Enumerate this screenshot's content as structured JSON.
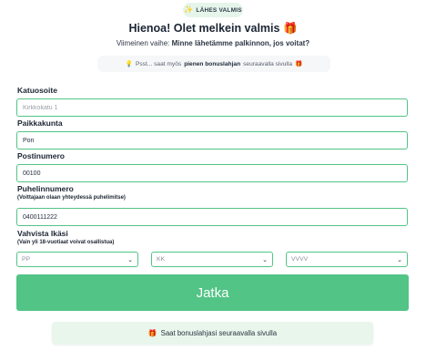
{
  "badge": {
    "icon": "magic-wand-icon",
    "text": "LÄHES VALMIS"
  },
  "header": {
    "title": "Hienoa! Olet melkein valmis",
    "title_icon": "gift-icon",
    "subtitle_prefix": "Viimeinen vaihe:",
    "subtitle_bold": "Minne lähetämme palkinnon, jos voitat?"
  },
  "tip": {
    "icon": "lightbulb-icon",
    "prefix": "Psst... saat myös",
    "bold": "pienen bonuslahjan",
    "suffix": "seuraavalla sivulla",
    "end_icon": "gift-icon"
  },
  "form": {
    "street": {
      "label": "Katuosoite",
      "placeholder": "Kirkkokatu 1"
    },
    "city": {
      "label": "Paikkakunta",
      "value": "Pori"
    },
    "postal": {
      "label": "Postinumero",
      "value": "00100"
    },
    "phone": {
      "label": "Puhelinnumero",
      "sublabel": "(Voittajaan olaan yhteydessä puhelimitse)",
      "value": "0400111222"
    },
    "age": {
      "label": "Vahvista Ikäsi",
      "sublabel": "(Vain yli 18-vuotiaat voivat osallistua)",
      "day": "PP",
      "month": "KK",
      "year": "VVVV"
    }
  },
  "submit_label": "Jatka",
  "footer": {
    "icon": "gift-icon",
    "text": "Saat bonuslahjasi seuraavalla sivulla"
  },
  "colors": {
    "accent": "#52c486",
    "badge_bg": "#e6f5ea",
    "footer_bg": "#e8f6ec",
    "gift": "#e08a1e"
  }
}
